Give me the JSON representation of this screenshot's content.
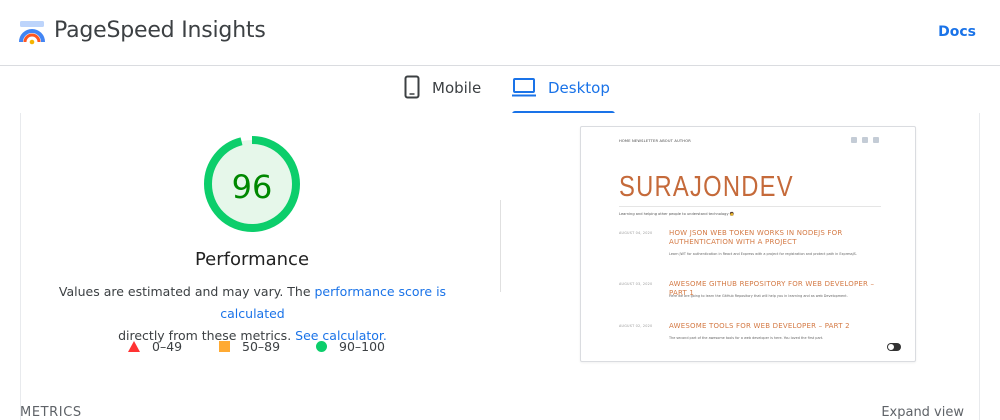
{
  "header": {
    "app_title": "PageSpeed Insights",
    "docs_label": "Docs"
  },
  "tabs": [
    {
      "label": "Mobile",
      "icon": "phone-icon",
      "active": false
    },
    {
      "label": "Desktop",
      "icon": "laptop-icon",
      "active": true
    }
  ],
  "performance": {
    "score": "96",
    "score_fraction": 0.96,
    "title": "Performance",
    "desc_prefix": "Values are estimated and may vary. The ",
    "desc_link1": "performance score is calculated",
    "desc_mid": " directly from these metrics. ",
    "desc_link2": "See calculator.",
    "colors": {
      "pass": "#0cce6b",
      "score_text": "#008800",
      "gauge_bg": "#e6f7ea"
    }
  },
  "legend": [
    {
      "shape": "triangle",
      "range": "0–49",
      "color": "#ff3333"
    },
    {
      "shape": "square",
      "range": "50–89",
      "color": "#ffaa33"
    },
    {
      "shape": "circle",
      "range": "90–100",
      "color": "#0cce6b"
    }
  ],
  "preview": {
    "nav": "HOME   NEWSLETTER   ABOUT AUTHOR",
    "brand": "SURAJONDEV",
    "tagline": "Learning and helping other people to understand technology 🧑",
    "posts": [
      {
        "date": "AUGUST 04, 2020",
        "title": "HOW JSON WEB TOKEN WORKS IN NODEJS FOR AUTHENTICATION WITH A PROJECT",
        "excerpt": "Learn JWT for authentication in React and Express with a project for registration and protect path in ExpressJS."
      },
      {
        "date": "AUGUST 03, 2020",
        "title": "AWESOME GITHUB REPOSITORY FOR WEB DEVELOPER – PART 1",
        "excerpt": "Here we are going to learn the GitHub Repository that will help you in learning and as web Development."
      },
      {
        "date": "AUGUST 02, 2020",
        "title": "AWESOME TOOLS FOR WEB DEVELOPER – PART 2",
        "excerpt": "The second part of the awesome tools for a web developer is here. You loved the first part."
      }
    ]
  },
  "metrics": {
    "label": "METRICS",
    "expand_label": "Expand view"
  }
}
